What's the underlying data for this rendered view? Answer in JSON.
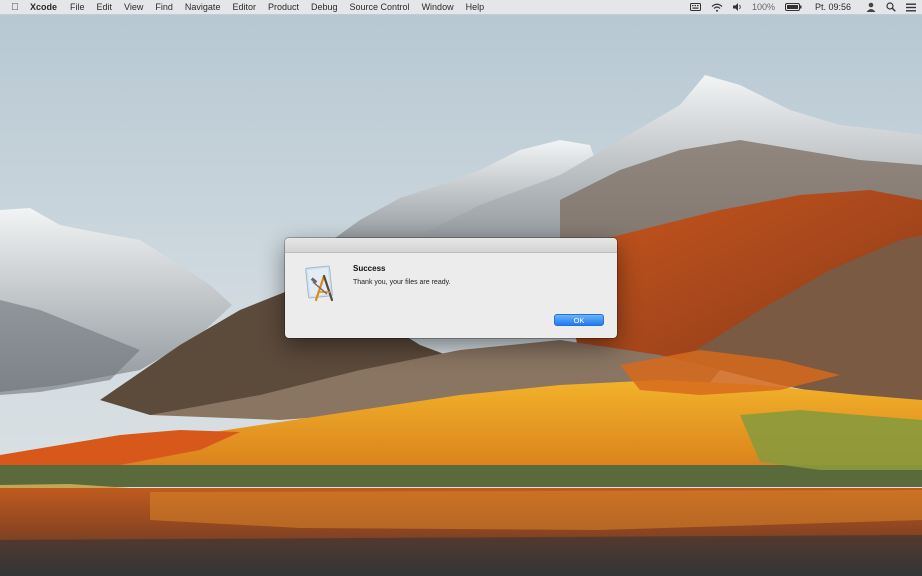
{
  "menubar": {
    "app_name": "Xcode",
    "items": [
      "File",
      "Edit",
      "View",
      "Find",
      "Navigate",
      "Editor",
      "Product",
      "Debug",
      "Source Control",
      "Window",
      "Help"
    ],
    "battery": "100%",
    "clock": "Pt. 09:56",
    "status_icons": [
      "keyboard-icon",
      "wifi-icon",
      "volume-icon",
      "battery-icon",
      "user-icon",
      "search-icon",
      "menu-icon"
    ]
  },
  "dialog": {
    "title": "Success",
    "message": "Thank you, your files are ready.",
    "ok_label": "OK",
    "icon": "xcode-icon"
  },
  "colors": {
    "accent": "#1f7cf0",
    "dialog_bg": "#ececec"
  }
}
